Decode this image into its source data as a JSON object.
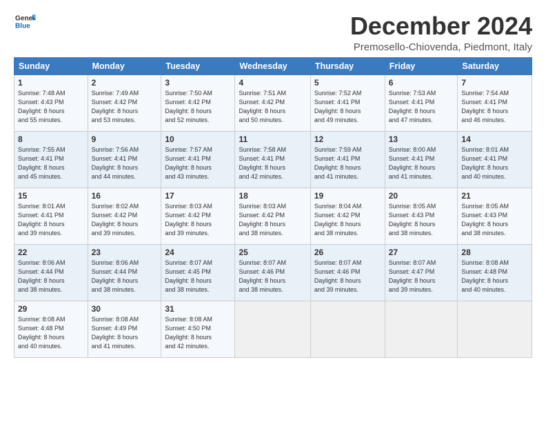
{
  "logo": {
    "line1": "General",
    "line2": "Blue"
  },
  "title": "December 2024",
  "subtitle": "Premosello-Chiovenda, Piedmont, Italy",
  "headers": [
    "Sunday",
    "Monday",
    "Tuesday",
    "Wednesday",
    "Thursday",
    "Friday",
    "Saturday"
  ],
  "weeks": [
    [
      {
        "day": "1",
        "info": "Sunrise: 7:48 AM\nSunset: 4:43 PM\nDaylight: 8 hours\nand 55 minutes."
      },
      {
        "day": "2",
        "info": "Sunrise: 7:49 AM\nSunset: 4:42 PM\nDaylight: 8 hours\nand 53 minutes."
      },
      {
        "day": "3",
        "info": "Sunrise: 7:50 AM\nSunset: 4:42 PM\nDaylight: 8 hours\nand 52 minutes."
      },
      {
        "day": "4",
        "info": "Sunrise: 7:51 AM\nSunset: 4:42 PM\nDaylight: 8 hours\nand 50 minutes."
      },
      {
        "day": "5",
        "info": "Sunrise: 7:52 AM\nSunset: 4:41 PM\nDaylight: 8 hours\nand 49 minutes."
      },
      {
        "day": "6",
        "info": "Sunrise: 7:53 AM\nSunset: 4:41 PM\nDaylight: 8 hours\nand 47 minutes."
      },
      {
        "day": "7",
        "info": "Sunrise: 7:54 AM\nSunset: 4:41 PM\nDaylight: 8 hours\nand 46 minutes."
      }
    ],
    [
      {
        "day": "8",
        "info": "Sunrise: 7:55 AM\nSunset: 4:41 PM\nDaylight: 8 hours\nand 45 minutes."
      },
      {
        "day": "9",
        "info": "Sunrise: 7:56 AM\nSunset: 4:41 PM\nDaylight: 8 hours\nand 44 minutes."
      },
      {
        "day": "10",
        "info": "Sunrise: 7:57 AM\nSunset: 4:41 PM\nDaylight: 8 hours\nand 43 minutes."
      },
      {
        "day": "11",
        "info": "Sunrise: 7:58 AM\nSunset: 4:41 PM\nDaylight: 8 hours\nand 42 minutes."
      },
      {
        "day": "12",
        "info": "Sunrise: 7:59 AM\nSunset: 4:41 PM\nDaylight: 8 hours\nand 41 minutes."
      },
      {
        "day": "13",
        "info": "Sunrise: 8:00 AM\nSunset: 4:41 PM\nDaylight: 8 hours\nand 41 minutes."
      },
      {
        "day": "14",
        "info": "Sunrise: 8:01 AM\nSunset: 4:41 PM\nDaylight: 8 hours\nand 40 minutes."
      }
    ],
    [
      {
        "day": "15",
        "info": "Sunrise: 8:01 AM\nSunset: 4:41 PM\nDaylight: 8 hours\nand 39 minutes."
      },
      {
        "day": "16",
        "info": "Sunrise: 8:02 AM\nSunset: 4:42 PM\nDaylight: 8 hours\nand 39 minutes."
      },
      {
        "day": "17",
        "info": "Sunrise: 8:03 AM\nSunset: 4:42 PM\nDaylight: 8 hours\nand 39 minutes."
      },
      {
        "day": "18",
        "info": "Sunrise: 8:03 AM\nSunset: 4:42 PM\nDaylight: 8 hours\nand 38 minutes."
      },
      {
        "day": "19",
        "info": "Sunrise: 8:04 AM\nSunset: 4:42 PM\nDaylight: 8 hours\nand 38 minutes."
      },
      {
        "day": "20",
        "info": "Sunrise: 8:05 AM\nSunset: 4:43 PM\nDaylight: 8 hours\nand 38 minutes."
      },
      {
        "day": "21",
        "info": "Sunrise: 8:05 AM\nSunset: 4:43 PM\nDaylight: 8 hours\nand 38 minutes."
      }
    ],
    [
      {
        "day": "22",
        "info": "Sunrise: 8:06 AM\nSunset: 4:44 PM\nDaylight: 8 hours\nand 38 minutes."
      },
      {
        "day": "23",
        "info": "Sunrise: 8:06 AM\nSunset: 4:44 PM\nDaylight: 8 hours\nand 38 minutes."
      },
      {
        "day": "24",
        "info": "Sunrise: 8:07 AM\nSunset: 4:45 PM\nDaylight: 8 hours\nand 38 minutes."
      },
      {
        "day": "25",
        "info": "Sunrise: 8:07 AM\nSunset: 4:46 PM\nDaylight: 8 hours\nand 38 minutes."
      },
      {
        "day": "26",
        "info": "Sunrise: 8:07 AM\nSunset: 4:46 PM\nDaylight: 8 hours\nand 39 minutes."
      },
      {
        "day": "27",
        "info": "Sunrise: 8:07 AM\nSunset: 4:47 PM\nDaylight: 8 hours\nand 39 minutes."
      },
      {
        "day": "28",
        "info": "Sunrise: 8:08 AM\nSunset: 4:48 PM\nDaylight: 8 hours\nand 40 minutes."
      }
    ],
    [
      {
        "day": "29",
        "info": "Sunrise: 8:08 AM\nSunset: 4:48 PM\nDaylight: 8 hours\nand 40 minutes."
      },
      {
        "day": "30",
        "info": "Sunrise: 8:08 AM\nSunset: 4:49 PM\nDaylight: 8 hours\nand 41 minutes."
      },
      {
        "day": "31",
        "info": "Sunrise: 8:08 AM\nSunset: 4:50 PM\nDaylight: 8 hours\nand 42 minutes."
      },
      null,
      null,
      null,
      null
    ]
  ]
}
